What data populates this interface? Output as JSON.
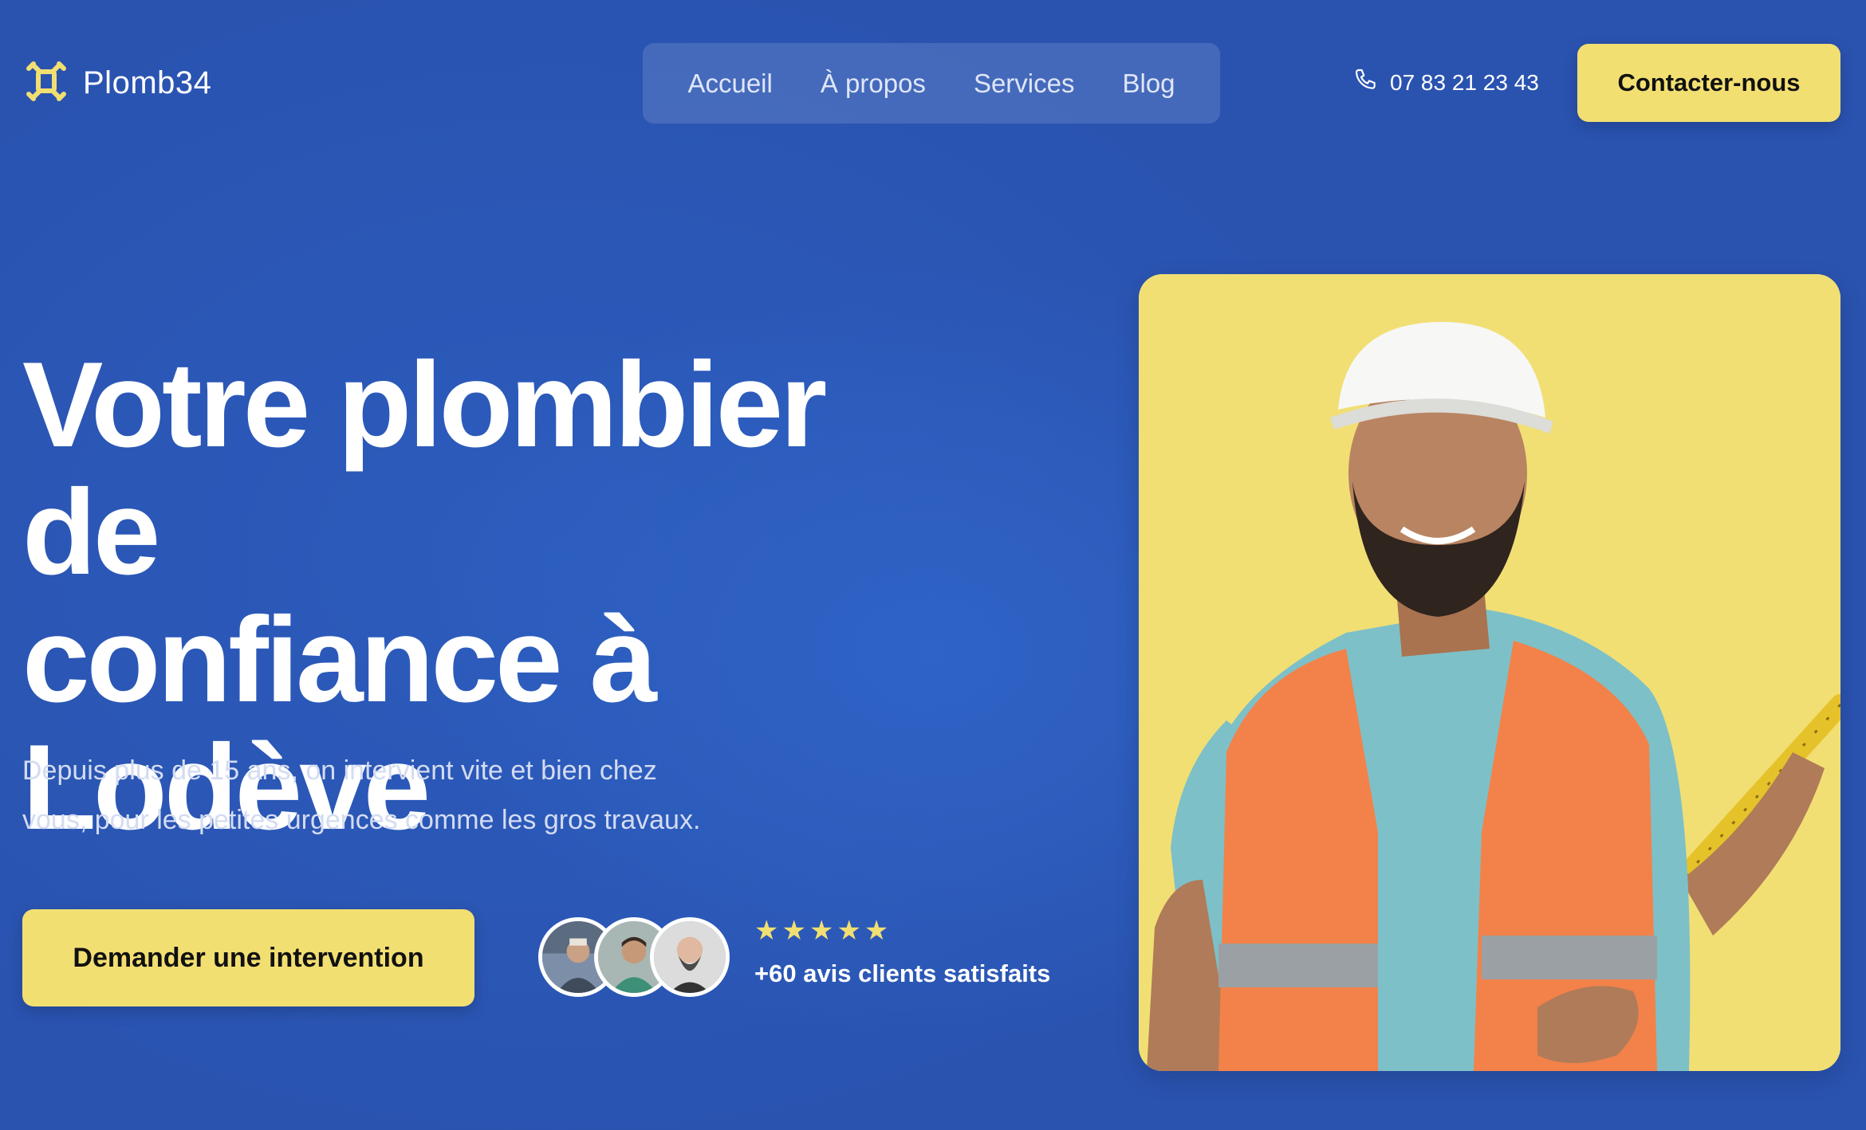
{
  "brand": {
    "name": "Plomb34",
    "logo_icon": "cross-logo-icon",
    "accent": "#f2df72"
  },
  "nav": {
    "items": [
      {
        "label": "Accueil"
      },
      {
        "label": "À propos"
      },
      {
        "label": "Services"
      },
      {
        "label": "Blog"
      }
    ]
  },
  "header": {
    "phone_icon": "phone-icon",
    "phone": "07 83 21 23 43",
    "contact_label": "Contacter-nous"
  },
  "hero": {
    "title_line1": "Votre plombier de",
    "title_line2": "confiance à",
    "title_line3": "Lodève",
    "subtitle_line1": "Depuis plus de 15 ans, on intervient vite et bien chez",
    "subtitle_line2": "vous, pour les petites urgences comme les gros travaux.",
    "cta_label": "Demander une intervention",
    "stars": "★★★★★",
    "reviews": "+60 avis clients satisfaits"
  },
  "colors": {
    "background": "#2a53b0",
    "card": "#f1df74",
    "button": "#f2df72"
  }
}
